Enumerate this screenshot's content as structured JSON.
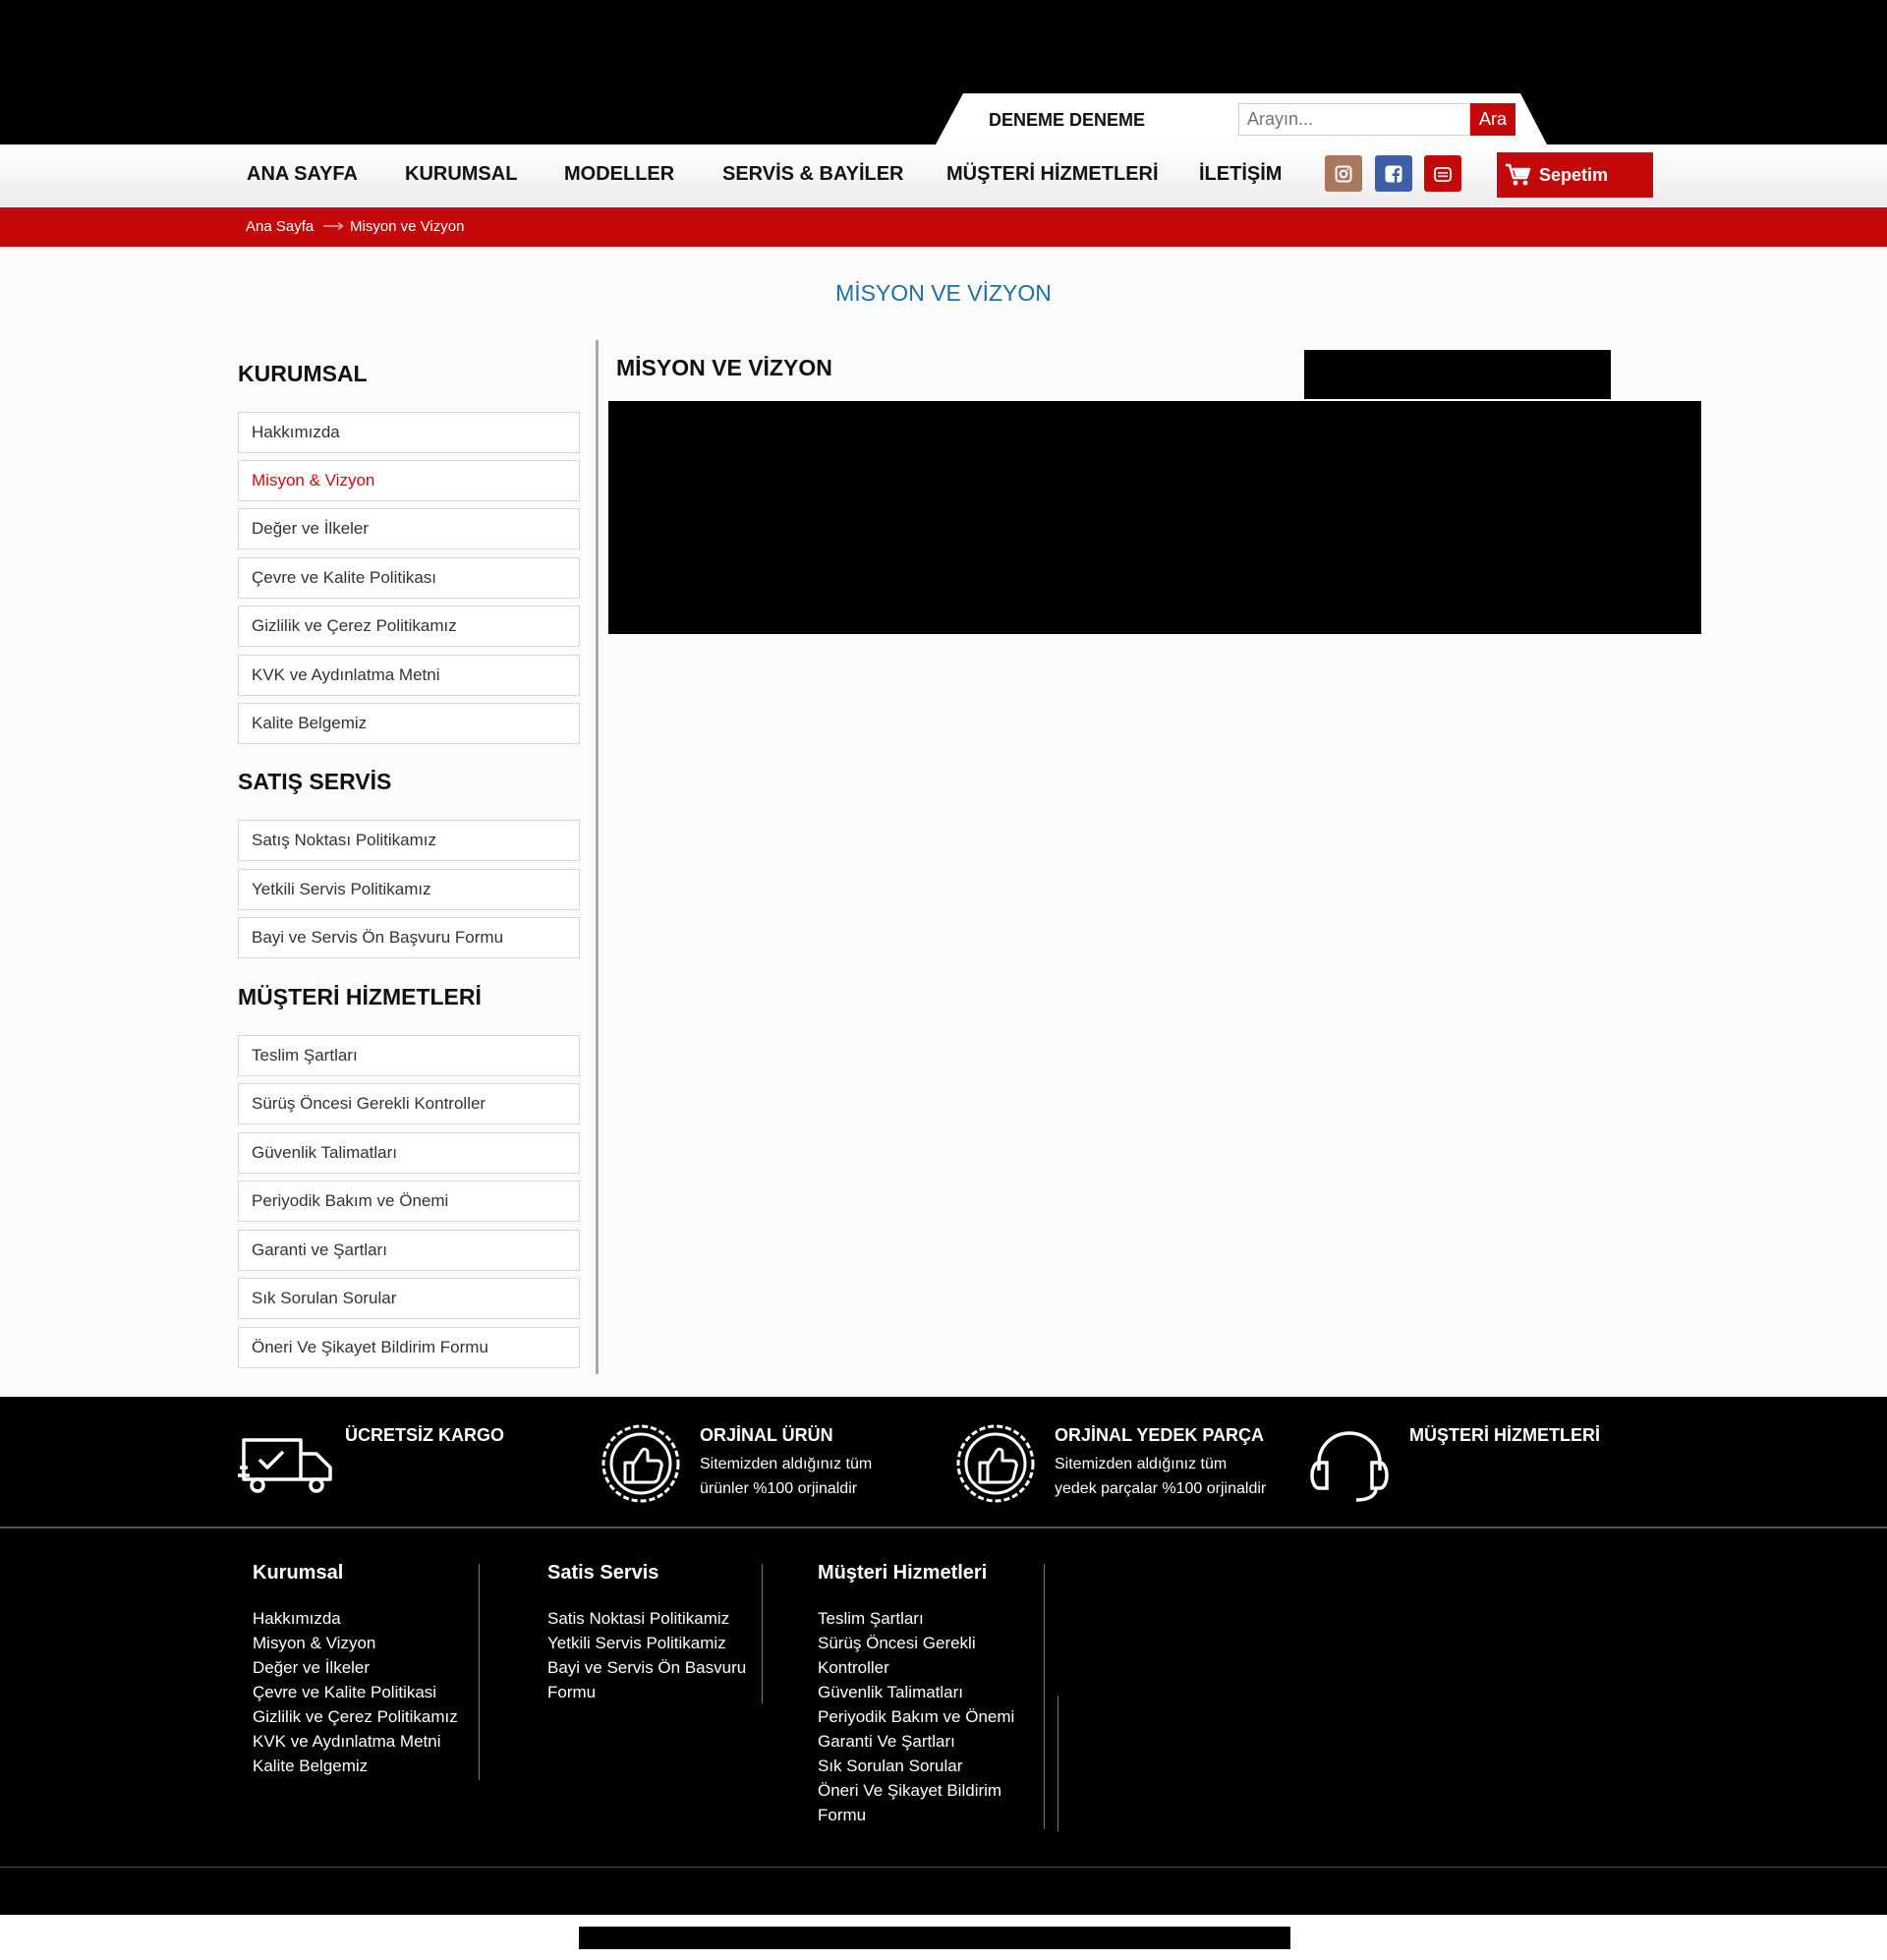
{
  "header": {
    "greeting": "DENEME DENEME",
    "search": {
      "placeholder": "Arayın...",
      "button_label": "Ara"
    }
  },
  "nav": {
    "items": [
      "ANA SAYFA",
      "KURUMSAL",
      "MODELLER",
      "SERVİS & BAYİLER",
      "MÜŞTERİ HİZMETLERİ",
      "İLETİŞİM"
    ],
    "social": [
      {
        "icon": "instagram-icon",
        "color": "#a9785c"
      },
      {
        "icon": "facebook-icon",
        "color": "#3c5fa6"
      },
      {
        "icon": "youtube-icon",
        "color": "#c4090b"
      }
    ],
    "cart_label": "Sepetim"
  },
  "breadcrumb": {
    "home": "Ana Sayfa",
    "current": "Misyon ve Vizyon"
  },
  "page_title": "MİSYON VE VİZYON",
  "sidebar": {
    "sections": [
      {
        "title": "KURUMSAL",
        "items": [
          "Hakkımızda",
          "Misyon & Vizyon",
          "Değer ve İlkeler",
          "Çevre ve Kalite Politikası",
          "Gizlilik ve Çerez Politikamız",
          "KVK ve Aydınlatma Metni",
          "Kalite Belgemiz"
        ]
      },
      {
        "title": "SATIŞ SERVİS",
        "items": [
          "Satış Noktası Politikamız",
          "Yetkili Servis Politikamız",
          "Bayi ve Servis Ön Başvuru Formu"
        ]
      },
      {
        "title": "MÜŞTERİ HİZMETLERİ",
        "items": [
          "Teslim Şartları",
          "Sürüş Öncesi Gerekli Kontroller",
          "Güvenlik Talimatları",
          "Periyodik Bakım ve Önemi",
          "Garanti ve Şartları",
          "Sık Sorulan Sorular",
          "Öneri Ve Şikayet Bildirim Formu"
        ]
      }
    ],
    "active_item": "Misyon & Vizyon"
  },
  "content": {
    "title": "MİSYON VE VİZYON"
  },
  "features": [
    {
      "icon": "truck-icon",
      "title": "ÜCRETSİZ KARGO",
      "lines": []
    },
    {
      "icon": "thumbs-up-badge-icon",
      "title": "ORJİNAL ÜRÜN",
      "lines": [
        "Sitemizden aldığınız tüm",
        "ürünler %100 orjinaldir"
      ]
    },
    {
      "icon": "thumbs-up-badge-icon",
      "title": "ORJİNAL YEDEK PARÇA",
      "lines": [
        "Sitemizden aldığınız tüm",
        "yedek parçalar %100 orjinaldir"
      ]
    },
    {
      "icon": "headset-icon",
      "title": "MÜŞTERİ HİZMETLERİ",
      "lines": []
    }
  ],
  "footer": {
    "columns": [
      {
        "title": "Kurumsal",
        "links": [
          "Hakkımızda",
          "Misyon & Vizyon",
          "Değer ve İlkeler",
          "Çevre ve Kalite Politikasi",
          "Gizlilik ve Çerez Politikamız",
          "KVK ve Aydınlatma Metni",
          "Kalite Belgemiz"
        ]
      },
      {
        "title": "Satis Servis",
        "links": [
          "Satis Noktasi Politikamiz",
          "Yetkili Servis Politikamiz",
          "Bayi ve Servis Ön Basvuru",
          "Formu"
        ]
      },
      {
        "title": "Müşteri Hizmetleri",
        "links": [
          "Teslim Şartları",
          "Sürüş Öncesi Gerekli",
          "Kontroller",
          "Güvenlik Talimatları",
          "Periyodik Bakım ve Önemi",
          "Garanti Ve Şartları",
          "Sık Sorulan Sorular",
          "Öneri Ve Şikayet Bildirim",
          "Formu"
        ]
      }
    ]
  },
  "colors": {
    "brand_red": "#c4090b",
    "title_blue": "#1e6fa9",
    "active_link": "#d2090b"
  }
}
